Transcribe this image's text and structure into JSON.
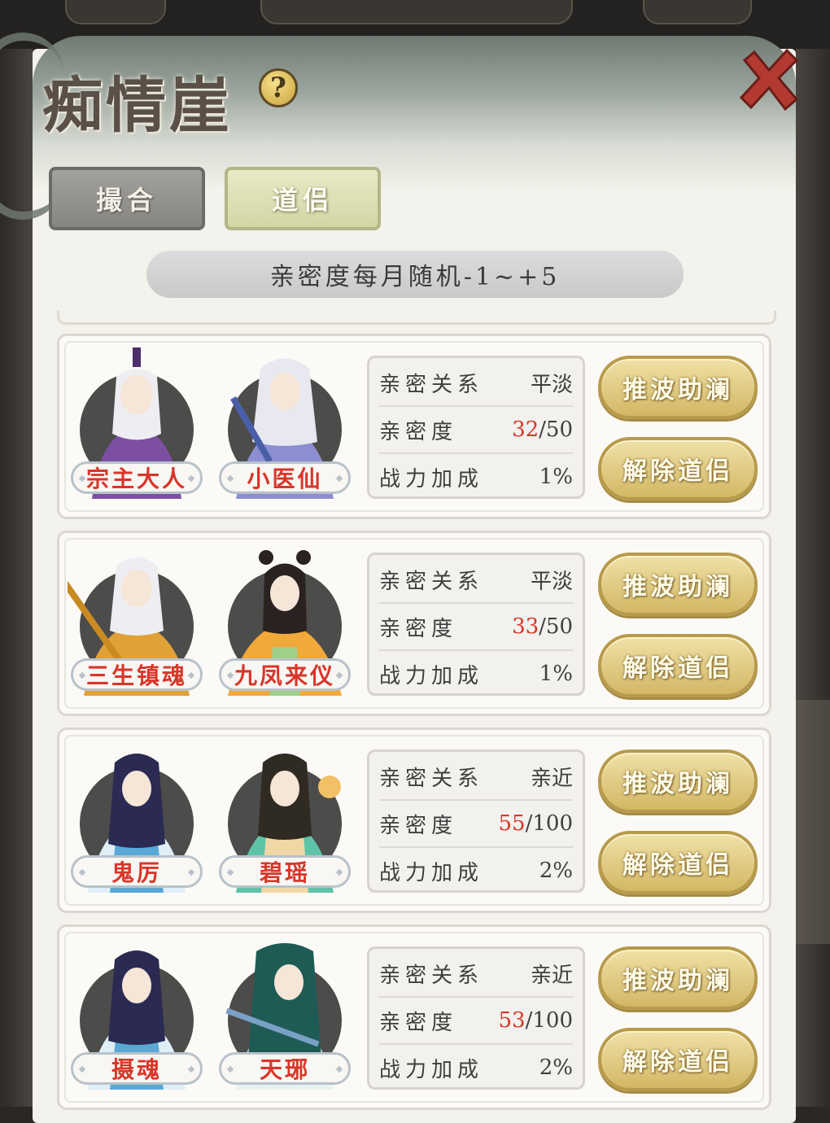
{
  "title": "痴情崖",
  "tabs": [
    {
      "label": "撮合",
      "active": false
    },
    {
      "label": "道侣",
      "active": true
    }
  ],
  "info_text": "亲密度每月随机-1~+5",
  "stat_labels": {
    "relation": "亲密关系",
    "intimacy": "亲密度",
    "power": "战力加成"
  },
  "buttons": {
    "boost": "推波助澜",
    "dissolve": "解除道侣"
  },
  "pairs": [
    {
      "left_name": "宗主大人",
      "right_name": "小医仙",
      "relation": "平淡",
      "intimacy": "32",
      "intimacy_max": "/50",
      "power": "1%"
    },
    {
      "left_name": "三生镇魂",
      "right_name": "九凤来仪",
      "relation": "平淡",
      "intimacy": "33",
      "intimacy_max": "/50",
      "power": "1%"
    },
    {
      "left_name": "鬼厉",
      "right_name": "碧瑶",
      "relation": "亲近",
      "intimacy": "55",
      "intimacy_max": "/100",
      "power": "2%"
    },
    {
      "left_name": "摄魂",
      "right_name": "天琊",
      "relation": "亲近",
      "intimacy": "53",
      "intimacy_max": "/100",
      "power": "2%"
    }
  ],
  "colors": {
    "accent_red": "#d9362a",
    "gold_button": "#d3b765",
    "panel": "#f4f2ec"
  }
}
